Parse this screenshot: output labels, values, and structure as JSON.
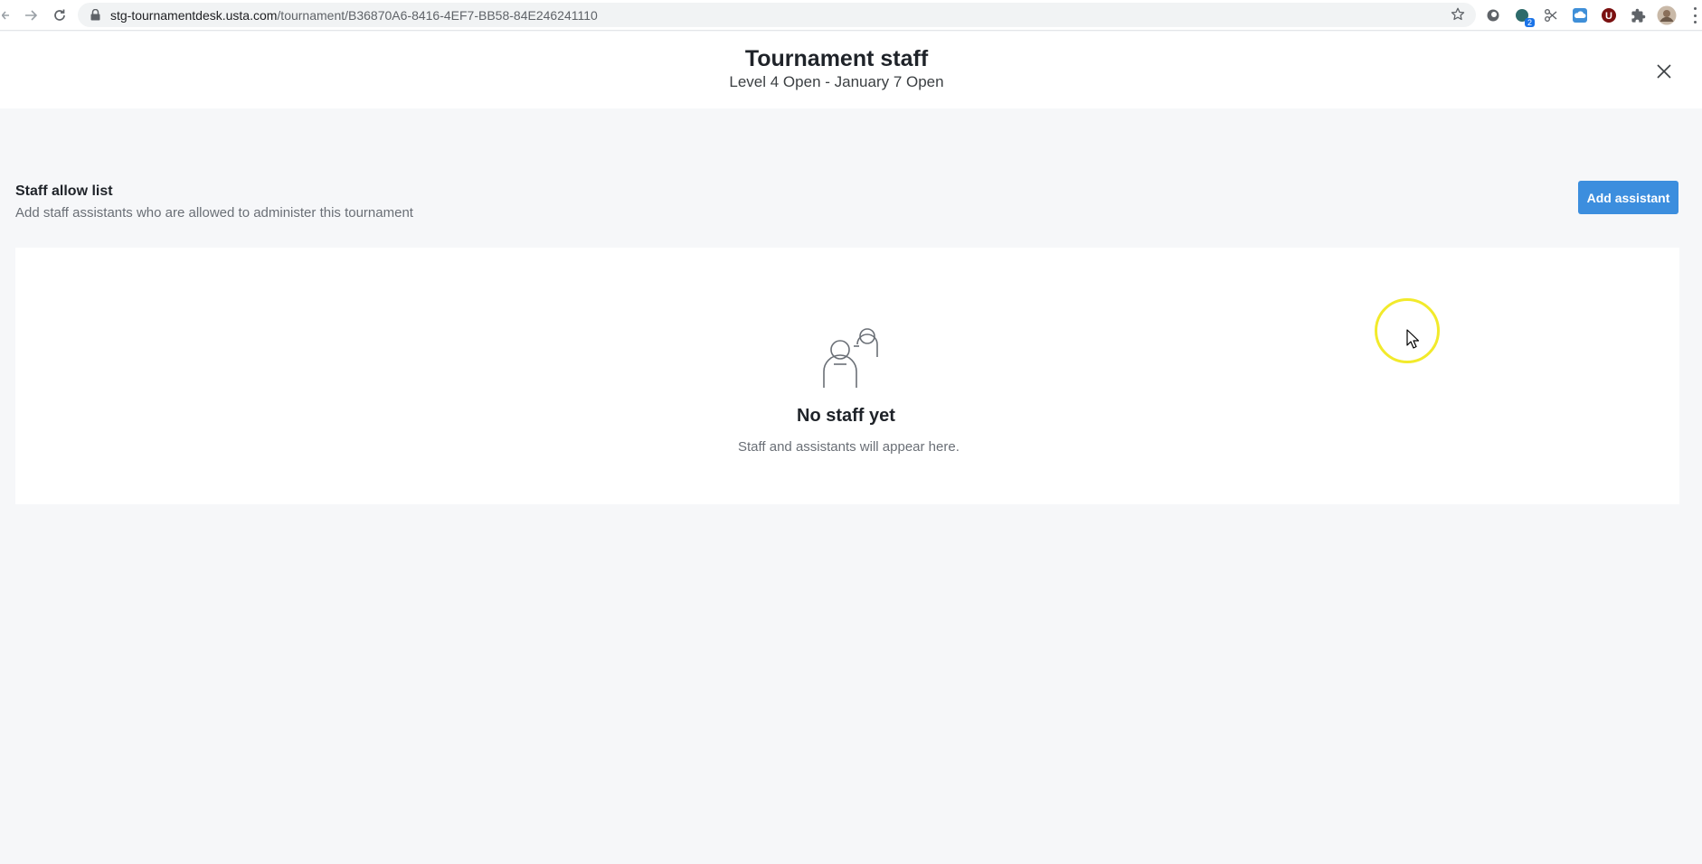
{
  "browser": {
    "url_host": "stg-tournamentdesk.usta.com",
    "url_path": "/tournament/B36870A6-8416-4EF7-BB58-84E246241110",
    "extensions": [
      {
        "name": "extension-1"
      },
      {
        "name": "extension-2",
        "badge": "2"
      },
      {
        "name": "extension-3"
      },
      {
        "name": "extension-4"
      },
      {
        "name": "extension-5",
        "letter": "U"
      },
      {
        "name": "extensions-puzzle"
      }
    ]
  },
  "header": {
    "title": "Tournament staff",
    "subtitle": "Level 4 Open - January 7 Open"
  },
  "section": {
    "title": "Staff allow list",
    "description": "Add staff assistants who are allowed to administer this tournament",
    "add_button_label": "Add assistant"
  },
  "empty_state": {
    "title": "No staff yet",
    "description": "Staff and assistants will appear here."
  },
  "colors": {
    "primary_button": "#3c8ede",
    "page_background": "#f6f7f9",
    "cursor_highlight": "#f2ea2b"
  }
}
